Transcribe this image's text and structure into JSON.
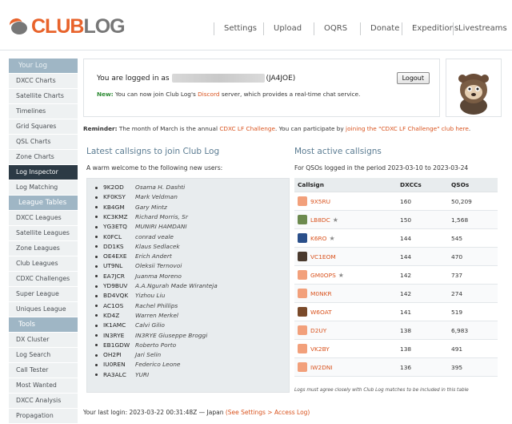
{
  "logo": {
    "part1": "CLUB",
    "part2": "LOG"
  },
  "nav": [
    {
      "label": "Settings"
    },
    {
      "label": "Upload"
    },
    {
      "label": "OQRS"
    },
    {
      "label": "Donate"
    },
    {
      "label": "Expeditions"
    },
    {
      "label": "Livestreams"
    }
  ],
  "sidebar": {
    "your_log_heading": "Your Log",
    "your_log": [
      "DXCC Charts",
      "Satellite Charts",
      "Timelines",
      "Grid Squares",
      "QSL Charts",
      "Zone Charts",
      "Log Inspector",
      "Log Matching"
    ],
    "active_item": "Log Inspector",
    "league_heading": "League Tables",
    "league": [
      "DXCC Leagues",
      "Satellite Leagues",
      "Zone Leagues",
      "Club Leagues",
      "CDXC Challenges",
      "Super League",
      "Uniques League"
    ],
    "tools_heading": "Tools",
    "tools": [
      "DX Cluster",
      "Log Search",
      "Call Tester",
      "Most Wanted",
      "DXCC Analysis",
      "Propagation"
    ]
  },
  "login": {
    "prefix": "You are logged in as",
    "callsign": "(JA4JOE)",
    "logout_label": "Logout",
    "new_label": "New:",
    "new_text_1": "You can now join Club Log's",
    "discord_link": "Discord",
    "new_text_2": "server, which provides a real-time chat service."
  },
  "reminder": {
    "label": "Reminder:",
    "text_1": "The month of March is the annual",
    "challenge_link": "CDXC LF Challenge",
    "text_2": ". You can participate by",
    "join_link": "joining the \"CDXC LF Challenge\" club here",
    "text_3": "."
  },
  "latest": {
    "heading": "Latest callsigns to join Club Log",
    "intro": "A warm welcome to the following new users:",
    "users": [
      {
        "call": "9K2OD",
        "name": "Osama H. Dashti"
      },
      {
        "call": "KF0KSY",
        "name": "Mark Veldman"
      },
      {
        "call": "KB4GM",
        "name": "Gary Mintz"
      },
      {
        "call": "KC3KMZ",
        "name": "Richard Morris, Sr"
      },
      {
        "call": "YG3ETQ",
        "name": "MUNIRI HAMDANI"
      },
      {
        "call": "K0FCL",
        "name": "conrad veale"
      },
      {
        "call": "DD1KS",
        "name": "Klaus Sedlacek"
      },
      {
        "call": "OE4EXE",
        "name": "Erich Andert"
      },
      {
        "call": "UT9NL",
        "name": "Oleksii Ternovoi"
      },
      {
        "call": "EA7JCR",
        "name": "Juanma Moreno"
      },
      {
        "call": "YD9BUV",
        "name": "A.A.Ngurah Made Wiranteja"
      },
      {
        "call": "BD4VQK",
        "name": "Yizhou Liu"
      },
      {
        "call": "AC1OS",
        "name": "Rachel Phillips"
      },
      {
        "call": "KD4Z",
        "name": "Warren Merkel"
      },
      {
        "call": "IK1AMC",
        "name": "Calvi Gilio"
      },
      {
        "call": "IN3RYE",
        "name": "IN3RYE Giuseppe Broggi"
      },
      {
        "call": "EB1GDW",
        "name": "Roberto Porto"
      },
      {
        "call": "OH2PI",
        "name": "Jari Selin"
      },
      {
        "call": "IU0REN",
        "name": "Federico Leone"
      },
      {
        "call": "RA3ALC",
        "name": "YURI"
      }
    ]
  },
  "active": {
    "heading": "Most active callsigns",
    "period": "For QSOs logged in the period 2023-03-10 to 2023-03-24",
    "columns": [
      "Callsign",
      "DXCCs",
      "QSOs"
    ],
    "rows": [
      {
        "call": "9X5RU",
        "dxcc": "160",
        "qsos": "50,209",
        "star": "",
        "pic": "#f2a07b"
      },
      {
        "call": "LB8DC",
        "dxcc": "150",
        "qsos": "1,568",
        "star": "★",
        "pic": "#6c8a4e"
      },
      {
        "call": "K6RO",
        "dxcc": "144",
        "qsos": "545",
        "star": "★",
        "pic": "#2a4f8a"
      },
      {
        "call": "VC1EOM",
        "dxcc": "144",
        "qsos": "470",
        "star": "",
        "pic": "#4a3a2e"
      },
      {
        "call": "GM0OPS",
        "dxcc": "142",
        "qsos": "737",
        "star": "★",
        "pic": "#f2a07b"
      },
      {
        "call": "M0NKR",
        "dxcc": "142",
        "qsos": "274",
        "star": "",
        "pic": "#f2a07b"
      },
      {
        "call": "W6OAT",
        "dxcc": "141",
        "qsos": "519",
        "star": "",
        "pic": "#7a4a2a"
      },
      {
        "call": "D2UY",
        "dxcc": "138",
        "qsos": "6,983",
        "star": "",
        "pic": "#f2a07b"
      },
      {
        "call": "VK2BY",
        "dxcc": "138",
        "qsos": "491",
        "star": "",
        "pic": "#f2a07b"
      },
      {
        "call": "IW2DNI",
        "dxcc": "136",
        "qsos": "395",
        "star": "",
        "pic": "#f2a07b"
      }
    ],
    "footnote": "Logs must agree closely with Club Log matches to be included in this table"
  },
  "last_login": {
    "text": "Your last login: 2023-03-22 00:31:48Z — Japan",
    "link": "(See Settings > Access Log)"
  },
  "colors": {
    "accent": "#e8632b",
    "sidebar_head": "#9fb6c5",
    "sidebar_active": "#2c3a45",
    "link": "#d9531e"
  }
}
